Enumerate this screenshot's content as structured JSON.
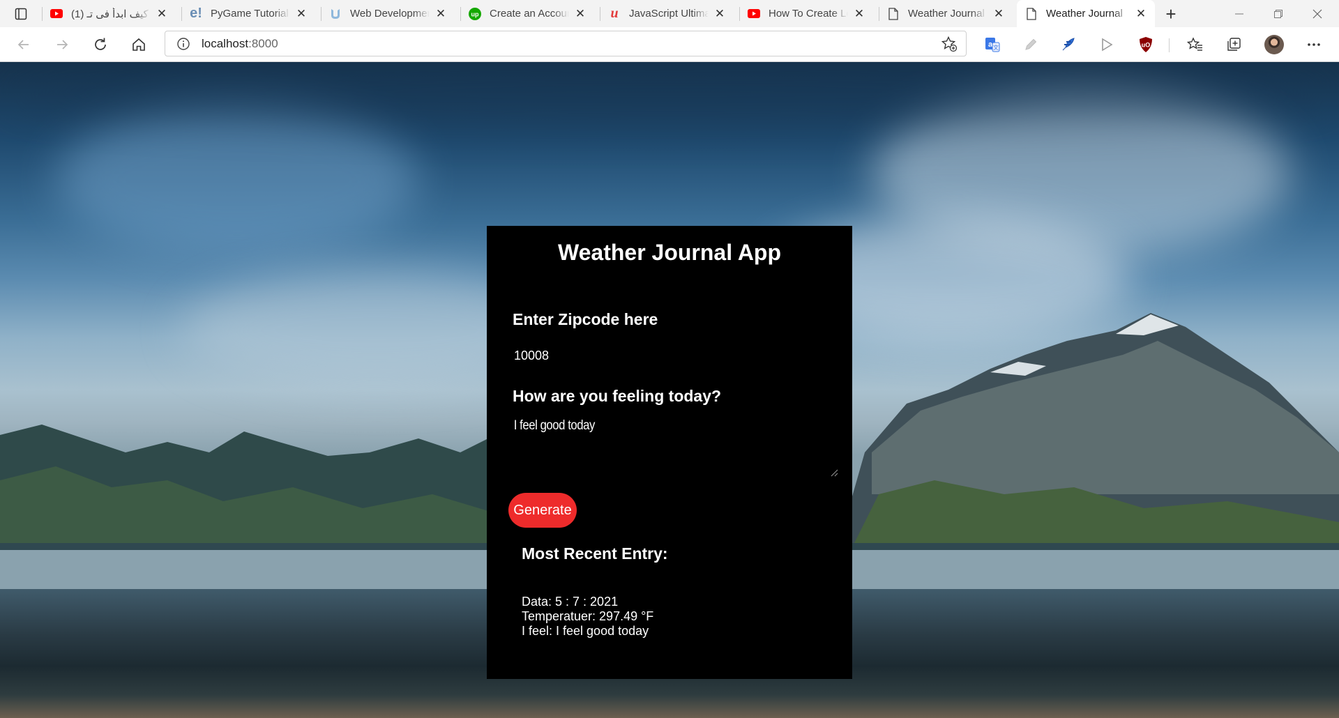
{
  "browser": {
    "tabs": [
      {
        "title": "(1) كيف ابدأ فى تـ",
        "icon": "youtube-icon",
        "active": false
      },
      {
        "title": "PyGame Tutorial",
        "icon": "e-letter-icon",
        "active": false
      },
      {
        "title": "Web Development",
        "icon": "udacity-icon",
        "active": false
      },
      {
        "title": "Create an Account",
        "icon": "upwork-icon",
        "active": false
      },
      {
        "title": "JavaScript Ultimate",
        "icon": "udemy-icon",
        "active": false
      },
      {
        "title": "How To Create Lo",
        "icon": "youtube-icon",
        "active": false
      },
      {
        "title": "Weather Journal",
        "icon": "page-icon",
        "active": false
      },
      {
        "title": "Weather Journal",
        "icon": "page-icon",
        "active": true
      }
    ],
    "address": {
      "host": "localhost",
      "port": ":8000"
    }
  },
  "app": {
    "title": "Weather Journal App",
    "zip_label": "Enter Zipcode here",
    "zip_value": "10008",
    "feel_label": "How are you feeling today?",
    "feel_value": "I feel good today",
    "generate_label": "Generate",
    "recent_title": "Most Recent Entry:",
    "entry": {
      "date": "Data: 5 : 7 : 2021",
      "temp": "Temperatuer: 297.49 °F",
      "content": "I feel: I feel good today"
    }
  },
  "colors": {
    "card_bg": "#000000",
    "button_bg": "#ee2b2b",
    "text": "#ffffff"
  }
}
